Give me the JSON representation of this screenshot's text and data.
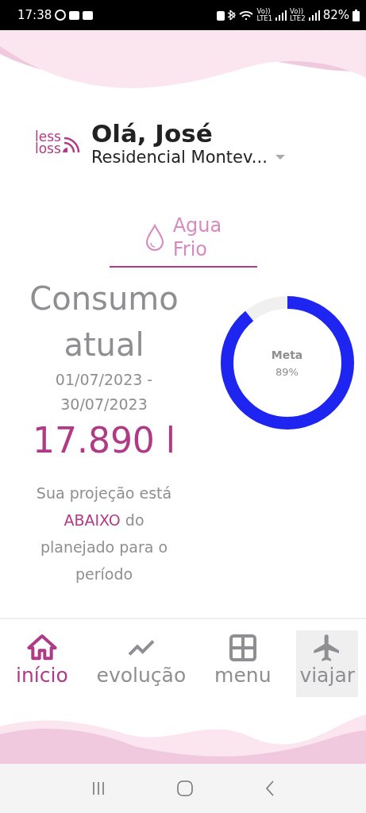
{
  "status_bar": {
    "time": "17:38",
    "sims": [
      {
        "top": "Vo))",
        "bottom": "LTE1"
      },
      {
        "top": "Vo))",
        "bottom": "LTE2"
      }
    ],
    "battery": "82%"
  },
  "header": {
    "logo": {
      "line1": "less",
      "line2": "loss"
    },
    "greeting": "Olá, José",
    "property": "Residencial Montev..."
  },
  "utility_tab": {
    "line1": "Agua",
    "line2": "Frio",
    "selected": true
  },
  "consumption": {
    "title": "Consumo atual",
    "period_start": "01/07/2023 -",
    "period_end": "30/07/2023",
    "value": "17.890 l",
    "projection_before": "Sua projeção está ",
    "projection_status": "ABAIXO",
    "projection_after": " do planejado para o período"
  },
  "goal_gauge": {
    "label": "Meta",
    "reading": "89%",
    "level": 0.89
  },
  "bottom_nav": [
    {
      "kind": "home",
      "label": "início",
      "selected": true,
      "pressed": false
    },
    {
      "kind": "chart",
      "label": "evolução",
      "selected": false,
      "pressed": false
    },
    {
      "kind": "grid",
      "label": "menu",
      "selected": false,
      "pressed": false
    },
    {
      "kind": "plane",
      "label": "viajar",
      "selected": false,
      "pressed": true
    }
  ]
}
